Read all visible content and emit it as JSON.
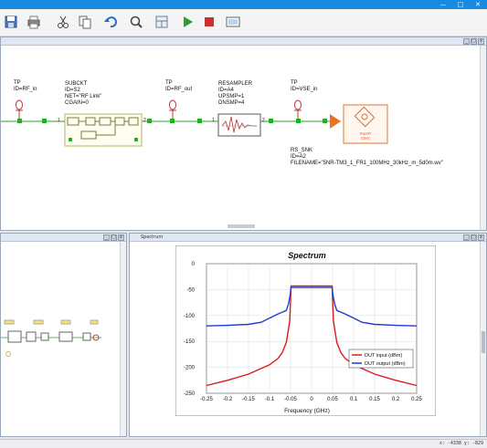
{
  "window": {
    "controls": [
      "—",
      "□",
      "✕"
    ]
  },
  "toolbar": {
    "icons": [
      "save-icon",
      "print-icon",
      "cut-icon",
      "copy-icon",
      "undo-icon",
      "zoom-icon",
      "layout-icon",
      "run-icon",
      "stop-icon",
      "view-icon"
    ]
  },
  "schematic": {
    "tp1": {
      "type": "TP",
      "id": "ID=RF_in"
    },
    "subckt": {
      "type": "SUBCKT",
      "id": "ID=S2",
      "net": "NET=\"RF Link\"",
      "cgain": "CGAIN=0"
    },
    "tp2": {
      "type": "TP",
      "id": "ID=RF_out"
    },
    "resampler": {
      "type": "RESAMPLER",
      "id": "ID=A4",
      "upsmp": "UPSMP=1",
      "dnsmp": "DNSMP=4"
    },
    "tp3": {
      "type": "TP",
      "id": "ID=VSE_in"
    },
    "rs_snk": {
      "type": "RS_SNK",
      "id": "ID=A2",
      "filename": "FILENAME=\"5NR-TM3_1_FR1_100MHz_30kHz_m_5d0m.wv\"",
      "block_text": "R&SR SINK"
    },
    "port_labels": [
      "1",
      "2",
      "1",
      "2"
    ]
  },
  "graph_window": {
    "title": "Spectrum"
  },
  "statusbar": {
    "coords": "x: -4338   y: -829"
  },
  "chart_data": {
    "type": "line",
    "title": "Spectrum",
    "xlabel": "Frequency (GHz)",
    "ylabel": "",
    "xlim": [
      -0.25,
      0.25
    ],
    "ylim": [
      -250,
      0
    ],
    "xticks": [
      "-0.25",
      "-0.2",
      "-0.15",
      "-0.1",
      "-0.05",
      "0",
      "0.05",
      "0.1",
      "0.15",
      "0.2",
      "0.25"
    ],
    "yticks": [
      "0",
      "-50",
      "-100",
      "-150",
      "-200",
      "-250"
    ],
    "grid": true,
    "legend_position": "bottom-right",
    "series": [
      {
        "name": "DUT input (dBm)",
        "color": "#e01818",
        "x": [
          -0.25,
          -0.2,
          -0.15,
          -0.1,
          -0.08,
          -0.07,
          -0.06,
          -0.055,
          -0.052,
          -0.05,
          -0.049,
          0,
          0.049,
          0.05,
          0.052,
          0.055,
          0.06,
          0.07,
          0.08,
          0.1,
          0.15,
          0.2,
          0.25
        ],
        "y": [
          -235,
          -225,
          -213,
          -195,
          -183,
          -172,
          -152,
          -126,
          -110,
          -70,
          -43,
          -43,
          -43,
          -70,
          -110,
          -126,
          -152,
          -172,
          -183,
          -195,
          -213,
          -225,
          -235
        ]
      },
      {
        "name": "DUT output (dBm)",
        "color": "#1f3bd6",
        "x": [
          -0.25,
          -0.2,
          -0.15,
          -0.12,
          -0.1,
          -0.08,
          -0.065,
          -0.06,
          -0.055,
          -0.052,
          -0.05,
          -0.049,
          0,
          0.049,
          0.05,
          0.052,
          0.055,
          0.06,
          0.065,
          0.08,
          0.1,
          0.12,
          0.15,
          0.2,
          0.25
        ],
        "y": [
          -120,
          -119,
          -117,
          -113,
          -105,
          -97,
          -92,
          -90,
          -78,
          -65,
          -55,
          -46,
          -46,
          -46,
          -55,
          -65,
          -78,
          -90,
          -92,
          -97,
          -105,
          -113,
          -117,
          -119,
          -120
        ]
      }
    ]
  }
}
